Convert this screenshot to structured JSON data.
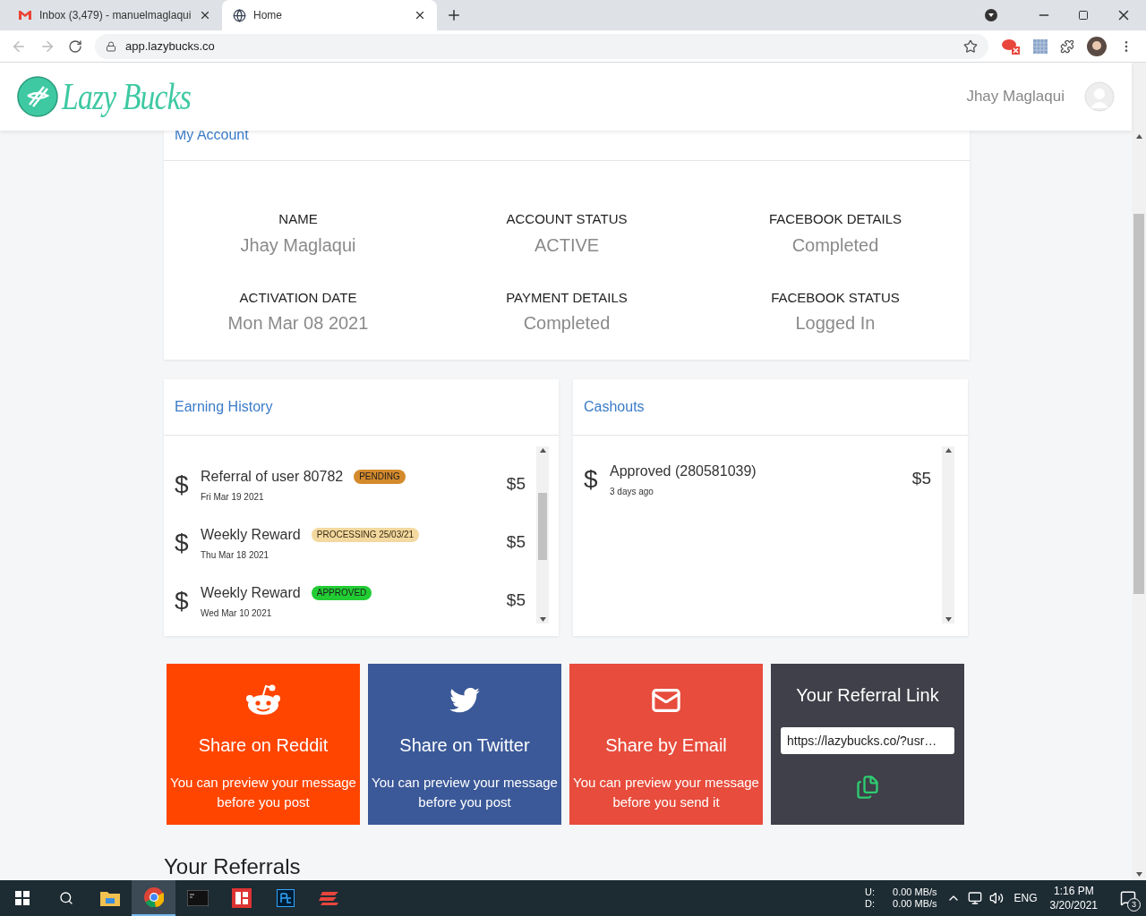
{
  "browser": {
    "tabs": [
      {
        "kind": "mail",
        "title": "Inbox (3,479) - manuelmaglaqui",
        "selected": false
      },
      {
        "kind": "globe",
        "title": "Home",
        "selected": true
      }
    ],
    "url": "app.lazybucks.co"
  },
  "header": {
    "brand": "Lazy Bucks",
    "user": "Jhay Maglaqui"
  },
  "account": {
    "title": "My Account",
    "fields": [
      {
        "label": "NAME",
        "value": "Jhay Maglaqui"
      },
      {
        "label": "ACCOUNT STATUS",
        "value": "ACTIVE"
      },
      {
        "label": "FACEBOOK DETAILS",
        "value": "Completed"
      },
      {
        "label": "ACTIVATION DATE",
        "value": "Mon Mar 08 2021"
      },
      {
        "label": "PAYMENT DETAILS",
        "value": "Completed"
      },
      {
        "label": "FACEBOOK STATUS",
        "value": "Logged In"
      }
    ]
  },
  "earning_history": {
    "title": "Earning History",
    "items": [
      {
        "symbol": "$",
        "title": "Referral of user 80782",
        "date": "Fri Mar 19 2021",
        "status": "PENDING",
        "color": "#d48a2c",
        "amount": "$5"
      },
      {
        "symbol": "$",
        "title": "Weekly Reward",
        "date": "Thu Mar 18 2021",
        "status": "PROCESSING 25/03/21",
        "color": "#f3d9a0",
        "amount": "$5"
      },
      {
        "symbol": "$",
        "title": "Weekly Reward",
        "date": "Wed Mar 10 2021",
        "status": "APPROVED",
        "color": "#22cc33",
        "amount": "$5"
      }
    ]
  },
  "cashouts": {
    "title": "Cashouts",
    "items": [
      {
        "symbol": "$",
        "title": "Approved (280581039)",
        "date": "3 days ago",
        "amount": "$5"
      }
    ]
  },
  "share_tiles": [
    {
      "kind": "reddit",
      "title": "Share on Reddit",
      "text": "You can preview your message before you post"
    },
    {
      "kind": "twitter",
      "title": "Share on Twitter",
      "text": "You can preview your message before you post"
    },
    {
      "kind": "email",
      "title": "Share by Email",
      "text": "You can preview your message before you send it"
    }
  ],
  "referral": {
    "title": "Your Referral Link",
    "link": "https://lazybucks.co/?usr…"
  },
  "referrals_heading": "Your Referrals",
  "taskbar": {
    "net": [
      {
        "label": "U:",
        "value": "0.00 MB/s"
      },
      {
        "label": "D:",
        "value": "0.00 MB/s"
      }
    ],
    "language": "ENG",
    "time": "1:16 PM",
    "date": "3/20/2021",
    "notifications": "3"
  }
}
